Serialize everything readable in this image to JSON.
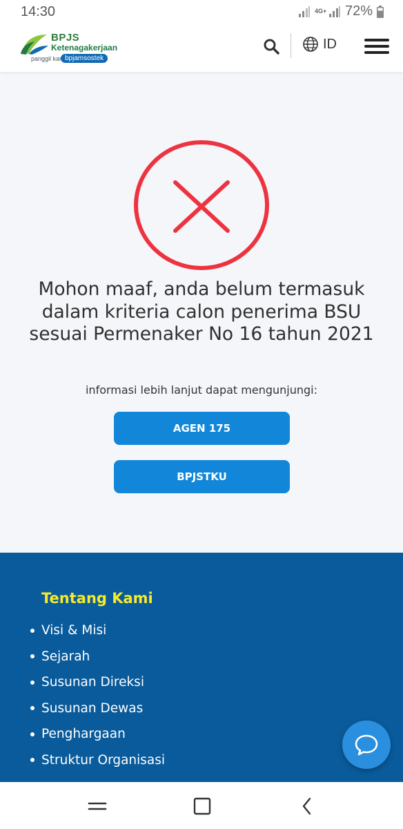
{
  "status_bar": {
    "time": "14:30",
    "network": "4G+",
    "battery_percent": "72%"
  },
  "header": {
    "logo": {
      "brand": "BPJS",
      "name": "Ketenagakerjaan",
      "tagline": "panggil kami",
      "pill": "bpjamsostek"
    },
    "language": "ID",
    "icons": [
      "search-icon",
      "globe-icon",
      "hamburger-menu-icon"
    ]
  },
  "main": {
    "status_icon": "error-x-icon",
    "status_color": "#ee3340",
    "message": "Mohon maaf, anda belum termasuk dalam kriteria calon penerima BSU sesuai Permenaker No 16 tahun 2021",
    "info_text": "informasi lebih lanjut dapat mengunjungi:",
    "buttons": [
      {
        "label": "AGEN 175"
      },
      {
        "label": "BPJSTKU"
      }
    ],
    "button_color": "#1287d9"
  },
  "footer": {
    "title": "Tentang Kami",
    "items": [
      "Visi & Misi",
      "Sejarah",
      "Susunan Direksi",
      "Susunan Dewas",
      "Penghargaan",
      "Struktur Organisasi"
    ],
    "background": "#0a5b9b",
    "title_color": "#f7ea2c"
  },
  "chat_button": {
    "icon": "chat-bubble-icon"
  },
  "nav_bar": {
    "icons": [
      "recent-apps-icon",
      "home-icon",
      "back-icon"
    ]
  }
}
